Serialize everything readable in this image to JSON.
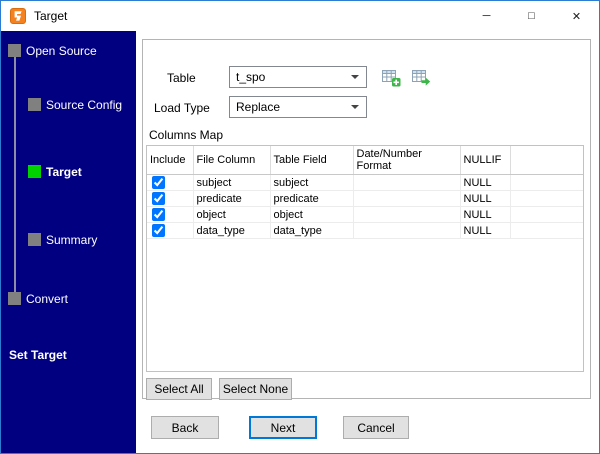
{
  "window": {
    "title": "Target",
    "controls": {
      "minimize": "─",
      "maximize": "□",
      "close": "✕"
    }
  },
  "sidebar": {
    "steps": [
      {
        "label": "Open Source",
        "state": "done"
      },
      {
        "label": "Source Config",
        "state": "done"
      },
      {
        "label": "Target",
        "state": "active"
      },
      {
        "label": "Summary",
        "state": "pending"
      },
      {
        "label": "Convert",
        "state": "pending"
      }
    ],
    "active_step": "Target",
    "footer": "Set Target"
  },
  "form": {
    "table": {
      "label": "Table",
      "value": "t_spo"
    },
    "load_type": {
      "label": "Load Type",
      "value": "Replace"
    },
    "columns_map_label": "Columns Map"
  },
  "grid": {
    "headers": [
      "Include",
      "File Column",
      "Table Field",
      "Date/Number Format",
      "NULLIF"
    ],
    "rows": [
      {
        "include": true,
        "file_column": "subject",
        "table_field": "subject",
        "format": "",
        "nullif": "NULL"
      },
      {
        "include": true,
        "file_column": "predicate",
        "table_field": "predicate",
        "format": "",
        "nullif": "NULL"
      },
      {
        "include": true,
        "file_column": "object",
        "table_field": "object",
        "format": "",
        "nullif": "NULL"
      },
      {
        "include": true,
        "file_column": "data_type",
        "table_field": "data_type",
        "format": "",
        "nullif": "NULL"
      }
    ]
  },
  "buttons": {
    "select_all": "Select All",
    "select_none": "Select None",
    "back": "Back",
    "next": "Next",
    "cancel": "Cancel"
  },
  "icons": {
    "app": "orange-data-logo",
    "toolbar": [
      "new-table-icon",
      "browse-table-icon"
    ]
  },
  "colors": {
    "sidebar_bg": "#000080",
    "active_step": "#00d300",
    "inactive_step": "#808080",
    "focus_border": "#0078d7",
    "logo_orange": "#f58220",
    "icon_green": "#3db54a"
  }
}
